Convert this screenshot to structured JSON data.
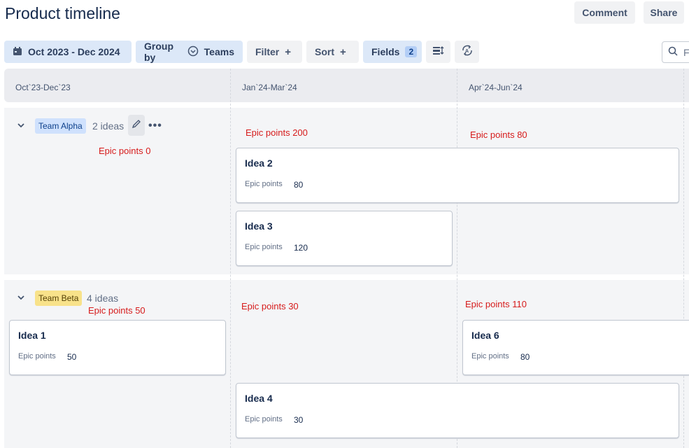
{
  "header": {
    "title": "Product timeline",
    "comment_label": "Comment",
    "share_label": "Share"
  },
  "toolbar": {
    "date_range": "Oct 2023 - Dec 2024",
    "group_by_label": "Group by",
    "group_by_value": "Teams",
    "filter_label": "Filter",
    "sort_label": "Sort",
    "fields_label": "Fields",
    "fields_count": "2",
    "search_placeholder": "F"
  },
  "columns": [
    {
      "label": "Oct`23-Dec`23"
    },
    {
      "label": "Jan`24-Mar`24"
    },
    {
      "label": "Apr`24-Jun`24"
    }
  ],
  "lanes": [
    {
      "team": "Team Alpha",
      "count": "2 ideas",
      "notes": [
        "Epic points 0",
        "Epic points 200",
        "Epic points 80"
      ],
      "cards": [
        {
          "title": "Idea 2",
          "field_label": "Epic points",
          "field_value": "80"
        },
        {
          "title": "Idea 3",
          "field_label": "Epic points",
          "field_value": "120"
        }
      ]
    },
    {
      "team": "Team Beta",
      "count": "4 ideas",
      "notes": [
        "Epic points 50",
        "Epic points 30",
        "Epic points 110"
      ],
      "cards": [
        {
          "title": "Idea 1",
          "field_label": "Epic points",
          "field_value": "50"
        },
        {
          "title": "Idea 6",
          "field_label": "Epic points",
          "field_value": "80"
        },
        {
          "title": "Idea 4",
          "field_label": "Epic points",
          "field_value": "30"
        }
      ]
    }
  ]
}
